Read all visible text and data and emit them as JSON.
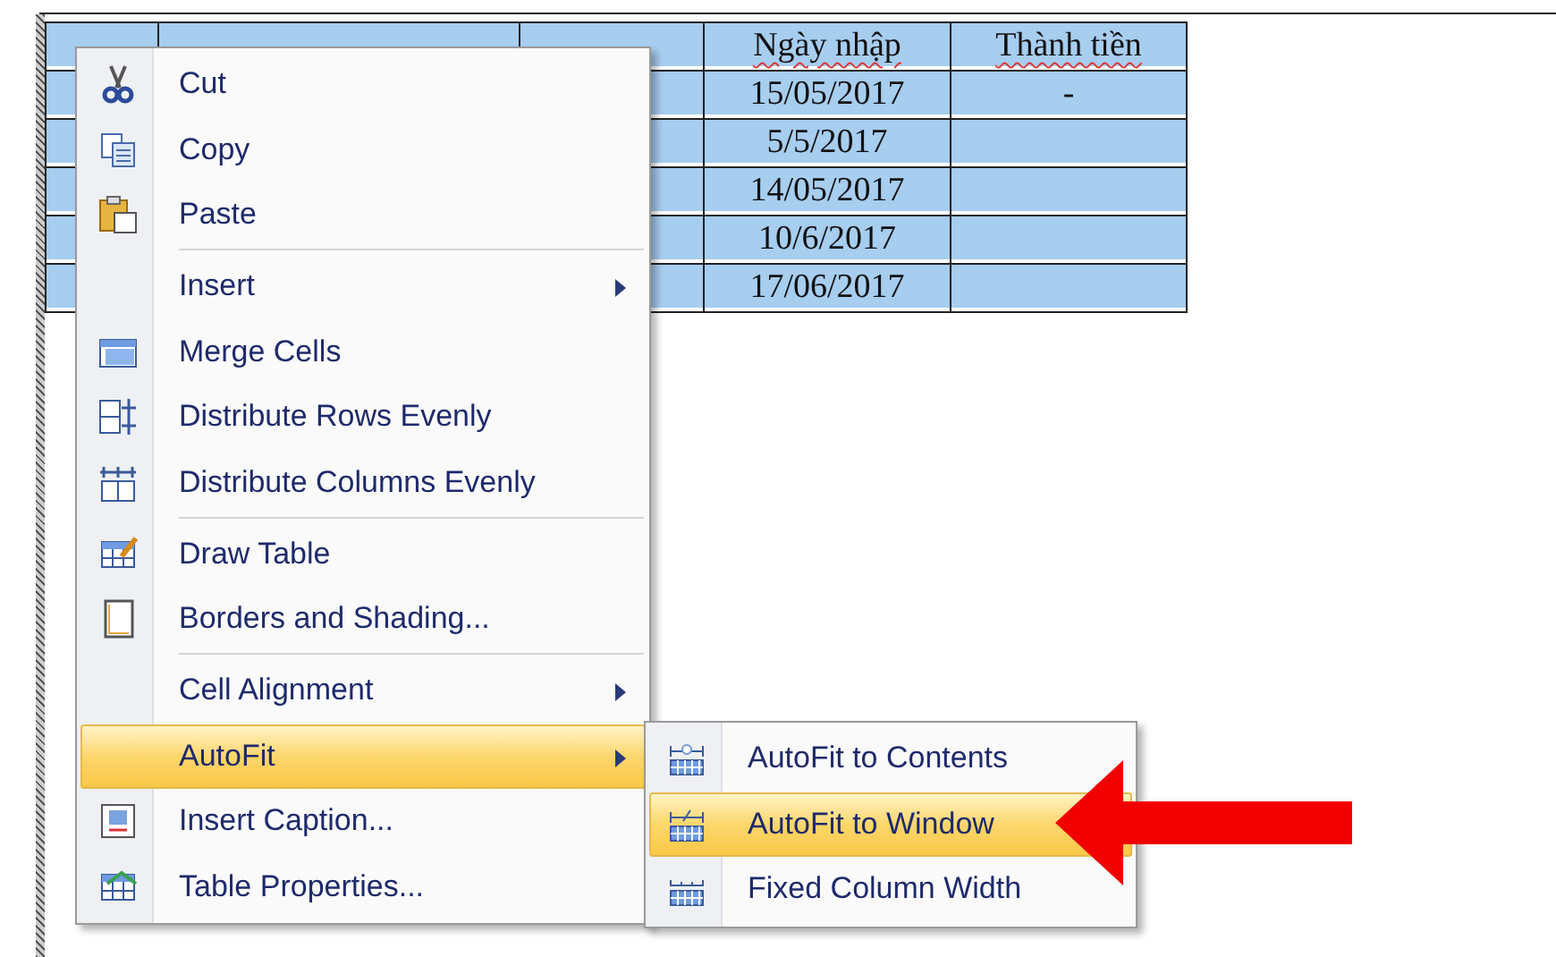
{
  "table": {
    "columns": [
      "Ngày nhập",
      "Thành tiền"
    ],
    "rows": [
      {
        "ngay_nhap": "15/05/2017",
        "thanh_tien": "-"
      },
      {
        "ngay_nhap": "5/5/2017"
      },
      {
        "ngay_nhap": "14/05/2017"
      },
      {
        "ngay_nhap": "10/6/2017"
      },
      {
        "ngay_nhap": "17/06/2017"
      }
    ]
  },
  "context_menu": {
    "items": [
      {
        "label": "Cut",
        "has_submenu": false,
        "selected": false,
        "separator_after": false
      },
      {
        "label": "Copy",
        "has_submenu": false,
        "selected": false,
        "separator_after": false
      },
      {
        "label": "Paste",
        "has_submenu": false,
        "selected": false,
        "separator_after": true
      },
      {
        "label": "Insert",
        "has_submenu": true,
        "selected": false,
        "separator_after": false
      },
      {
        "label": "Merge Cells",
        "has_submenu": false,
        "selected": false,
        "separator_after": false
      },
      {
        "label": "Distribute Rows Evenly",
        "has_submenu": false,
        "selected": false,
        "separator_after": false
      },
      {
        "label": "Distribute Columns Evenly",
        "has_submenu": false,
        "selected": false,
        "separator_after": true
      },
      {
        "label": "Draw Table",
        "has_submenu": false,
        "selected": false,
        "separator_after": false
      },
      {
        "label": "Borders and Shading...",
        "has_submenu": false,
        "selected": false,
        "separator_after": true
      },
      {
        "label": "Cell Alignment",
        "has_submenu": true,
        "selected": false,
        "separator_after": false
      },
      {
        "label": "AutoFit",
        "has_submenu": true,
        "selected": true,
        "separator_after": false
      },
      {
        "label": "Insert Caption...",
        "has_submenu": false,
        "selected": false,
        "separator_after": false
      },
      {
        "label": "Table Properties...",
        "has_submenu": false,
        "selected": false,
        "separator_after": false
      }
    ]
  },
  "submenu": {
    "items": [
      {
        "label": "AutoFit to Contents",
        "selected": false
      },
      {
        "label": "AutoFit to Window",
        "selected": true
      },
      {
        "label": "Fixed Column Width",
        "selected": false
      }
    ]
  }
}
